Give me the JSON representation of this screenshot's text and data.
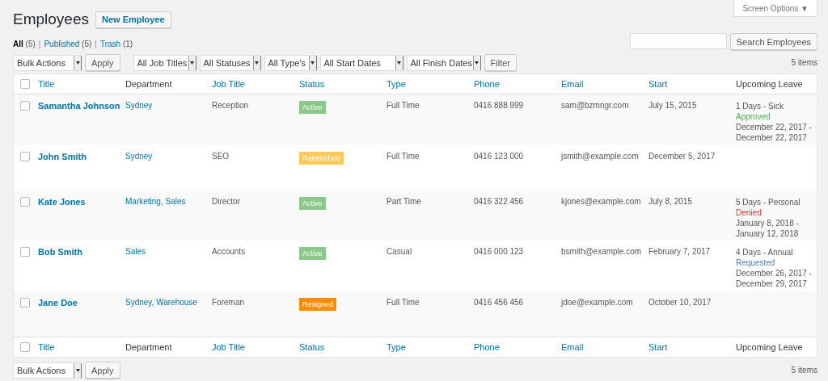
{
  "title": "Employees",
  "new_button": "New Employee",
  "screen_options": "Screen Options ▼",
  "views": [
    {
      "label": "All",
      "count": "(5)",
      "selected": true
    },
    {
      "separator": "|",
      "label": "Published",
      "count": "(5)",
      "selected": false
    },
    {
      "separator": "|",
      "label": "Trash",
      "count": "(1)",
      "selected": false
    }
  ],
  "search": {
    "button": "Search Employees"
  },
  "top_actions": {
    "bulk": "Bulk Actions",
    "apply": "Apply",
    "count": "5 items"
  },
  "filters": [
    {
      "label": "All Job Titles"
    },
    {
      "label": "All Statuses"
    },
    {
      "label": "All Type's"
    },
    {
      "label": "All Start Dates"
    },
    {
      "label": "All Finish Dates"
    }
  ],
  "filter_button": "Filter",
  "header": {
    "select_all_checked": false,
    "columns": [
      {
        "label": "Title",
        "sortable": true
      },
      {
        "label": "Department",
        "sortable": false
      },
      {
        "label": "Job Title",
        "sortable": true
      },
      {
        "label": "Status",
        "sortable": true
      },
      {
        "label": "Type",
        "sortable": true
      },
      {
        "label": "Phone",
        "sortable": true
      },
      {
        "label": "Email",
        "sortable": true
      },
      {
        "label": "Start",
        "sortable": true
      },
      {
        "label": "Upcoming Leave",
        "sortable": false
      }
    ]
  },
  "rows": [
    {
      "checked": false,
      "name": "Samantha Johnson",
      "department": "Sydney",
      "job": "Reception",
      "status": {
        "label": "Active",
        "color": "#8bc98b"
      },
      "type": "Full Time",
      "phone": "0416 888 999",
      "email": "sam@bzmngr.com",
      "start": "July 15, 2015",
      "leave": {
        "summary": "1 Days - Sick",
        "status": "Approved",
        "color": "#46b450",
        "dates": [
          "December 22, 2017 -",
          "December 22, 2017"
        ]
      }
    },
    {
      "checked": false,
      "name": "John Smith",
      "department": "Sydney",
      "job": "SEO",
      "status": {
        "label": "Retrenched",
        "color": "#fcc95c"
      },
      "type": "Full Time",
      "phone": "0416 123 000",
      "email": "jsmith@example.com",
      "start": "December 5, 2017"
    },
    {
      "checked": false,
      "name": "Kate Jones",
      "department": "Marketing, Sales",
      "job": "Director",
      "status": {
        "label": "Active",
        "color": "#8bc98b"
      },
      "type": "Part Time",
      "phone": "0416 322 456",
      "email": "kjones@example.com",
      "start": "July 8, 2015",
      "leave": {
        "summary": "5 Days - Personal",
        "status": "Denied",
        "color": "#dc3232",
        "dates": [
          "January 8, 2018 -",
          "January 12, 2018"
        ]
      }
    },
    {
      "checked": false,
      "name": "Bob Smith",
      "department": "Sales",
      "job": "Accounts",
      "status": {
        "label": "Active",
        "color": "#8bc98b"
      },
      "type": "Casual",
      "phone": "0416 000 123",
      "email": "bsmith@example.com",
      "start": "February 7, 2017",
      "leave": {
        "summary": "4 Days - Annual",
        "status": "Requested",
        "color": "#4a7fc1",
        "dates": [
          "December 26, 2017 -",
          "December 29, 2017"
        ]
      }
    },
    {
      "checked": false,
      "name": "Jane Doe",
      "department": "Sydney, Warehouse",
      "job": "Foreman",
      "status": {
        "label": "Resigned",
        "color": "#ff8c00"
      },
      "type": "Full Time",
      "phone": "0416 456 456",
      "email": "jdoe@example.com",
      "start": "October 10, 2017"
    }
  ],
  "footer": {
    "select_all_checked": false,
    "columns": [
      {
        "label": "Title",
        "sortable": true
      },
      {
        "label": "Department",
        "sortable": false
      },
      {
        "label": "Job Title",
        "sortable": true
      },
      {
        "label": "Status",
        "sortable": true
      },
      {
        "label": "Type",
        "sortable": true
      },
      {
        "label": "Phone",
        "sortable": true
      },
      {
        "label": "Email",
        "sortable": true
      },
      {
        "label": "Start",
        "sortable": true
      },
      {
        "label": "Upcoming Leave",
        "sortable": false
      }
    ]
  },
  "bottom_actions": {
    "bulk": "Bulk Actions",
    "apply": "Apply",
    "count": "5 items"
  }
}
